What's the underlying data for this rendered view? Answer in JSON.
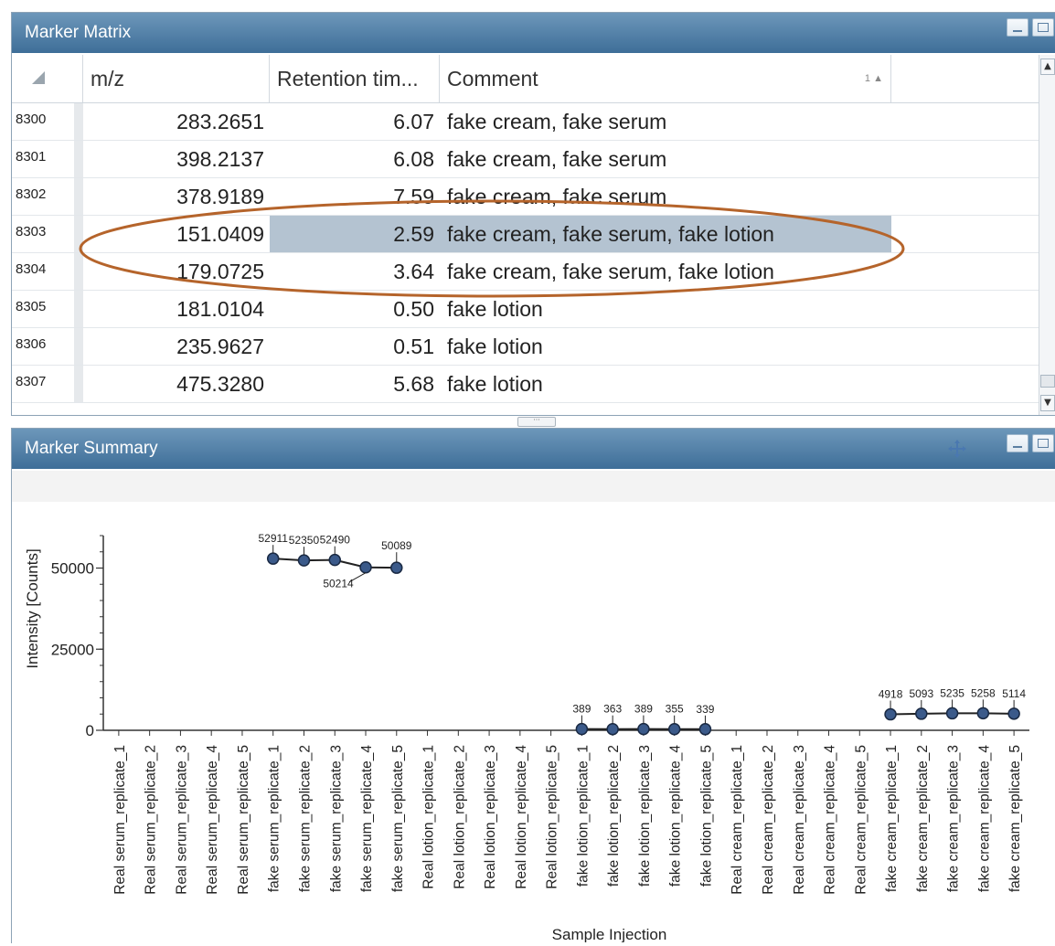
{
  "marker_matrix": {
    "title": "Marker Matrix",
    "columns": [
      "m/z",
      "Retention tim...",
      "Comment"
    ],
    "sort_indicator": "1",
    "rows": [
      {
        "id": "8300",
        "mz": "283.2651",
        "rt": "6.07",
        "comment": "fake cream, fake serum"
      },
      {
        "id": "8301",
        "mz": "398.2137",
        "rt": "6.08",
        "comment": "fake cream, fake serum"
      },
      {
        "id": "8302",
        "mz": "378.9189",
        "rt": "7.59",
        "comment": "fake cream, fake serum"
      },
      {
        "id": "8303",
        "mz": "151.0409",
        "rt": "2.59",
        "comment": "fake cream, fake serum, fake lotion"
      },
      {
        "id": "8304",
        "mz": "179.0725",
        "rt": "3.64",
        "comment": "fake cream, fake serum, fake lotion"
      },
      {
        "id": "8305",
        "mz": "181.0104",
        "rt": "0.50",
        "comment": "fake lotion"
      },
      {
        "id": "8306",
        "mz": "235.9627",
        "rt": "0.51",
        "comment": "fake lotion"
      },
      {
        "id": "8307",
        "mz": "475.3280",
        "rt": "5.68",
        "comment": "fake lotion"
      }
    ]
  },
  "marker_summary": {
    "title": "Marker Summary"
  },
  "colors": {
    "highlight_ellipse": "#b5642b",
    "selected_row": "#b4c3d1",
    "marker_fill": "#3b5a8a"
  },
  "chart_data": {
    "type": "line",
    "xlabel": "Sample Injection",
    "ylabel": "Intensity [Counts]",
    "ylim": [
      0,
      60000
    ],
    "yticks": [
      0,
      25000,
      50000
    ],
    "ytick_labels": [
      "0",
      "25000",
      "50000"
    ],
    "categories": [
      "Real serum_replicate_1",
      "Real serum_replicate_2",
      "Real serum_replicate_3",
      "Real serum_replicate_4",
      "Real serum_replicate_5",
      "fake serum_replicate_1",
      "fake serum_replicate_2",
      "fake serum_replicate_3",
      "fake serum_replicate_4",
      "fake serum_replicate_5",
      "Real lotion_replicate_1",
      "Real lotion_replicate_2",
      "Real lotion_replicate_3",
      "Real lotion_replicate_4",
      "Real lotion_replicate_5",
      "fake lotion_replicate_1",
      "fake lotion_replicate_2",
      "fake lotion_replicate_3",
      "fake lotion_replicate_4",
      "fake lotion_replicate_5",
      "Real cream_replicate_1",
      "Real cream_replicate_2",
      "Real cream_replicate_3",
      "Real cream_replicate_4",
      "Real cream_replicate_5",
      "fake cream_replicate_1",
      "fake cream_replicate_2",
      "fake cream_replicate_3",
      "fake cream_replicate_4",
      "fake cream_replicate_5"
    ],
    "groups": [
      {
        "start": 5,
        "values": [
          52911,
          52350,
          52490,
          50214,
          50089
        ],
        "labels": [
          "52911",
          "52350",
          "52490",
          "50214",
          "50089"
        ]
      },
      {
        "start": 15,
        "values": [
          389,
          363,
          389,
          355,
          339
        ],
        "labels": [
          "389",
          "363",
          "389",
          "355",
          "339"
        ]
      },
      {
        "start": 25,
        "values": [
          4918,
          5093,
          5235,
          5258,
          5114
        ],
        "labels": [
          "4918",
          "5093",
          "5235",
          "5258",
          "5114"
        ]
      }
    ]
  }
}
